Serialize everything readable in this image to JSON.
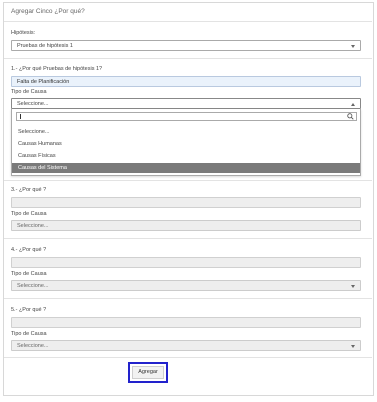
{
  "title": "Agregar Cinco ¿Por qué?",
  "hipotesis": {
    "label": "Hipótesis:",
    "value": "Pruebas de hipótesis 1"
  },
  "q1": {
    "label": "1.- ¿Por qué Pruebas de hipótesis 1?",
    "value": "Falta de Planificación",
    "tipo_label": "Tipo de Causa",
    "tipo_value": "Seleccione...",
    "dropdown": {
      "search_value": "",
      "options": [
        "Seleccione...",
        "Causas Humanas",
        "Causas Físicas",
        "Causas del Sistema"
      ],
      "highlighted": "Causas del Sistema"
    }
  },
  "q3": {
    "label": "3.- ¿Por qué ?",
    "tipo_label": "Tipo de Causa",
    "tipo_value": "Seleccione..."
  },
  "q4": {
    "label": "4.- ¿Por qué ?",
    "tipo_label": "Tipo de Causa",
    "tipo_value": "Seleccione..."
  },
  "q5": {
    "label": "5.- ¿Por qué ?",
    "tipo_label": "Tipo de Causa",
    "tipo_value": "Seleccione..."
  },
  "submit_label": "Agregar",
  "colors": {
    "highlight": "#7a7a7a",
    "button_outline": "#2222cc",
    "filled_input": "#eaf2fb"
  }
}
